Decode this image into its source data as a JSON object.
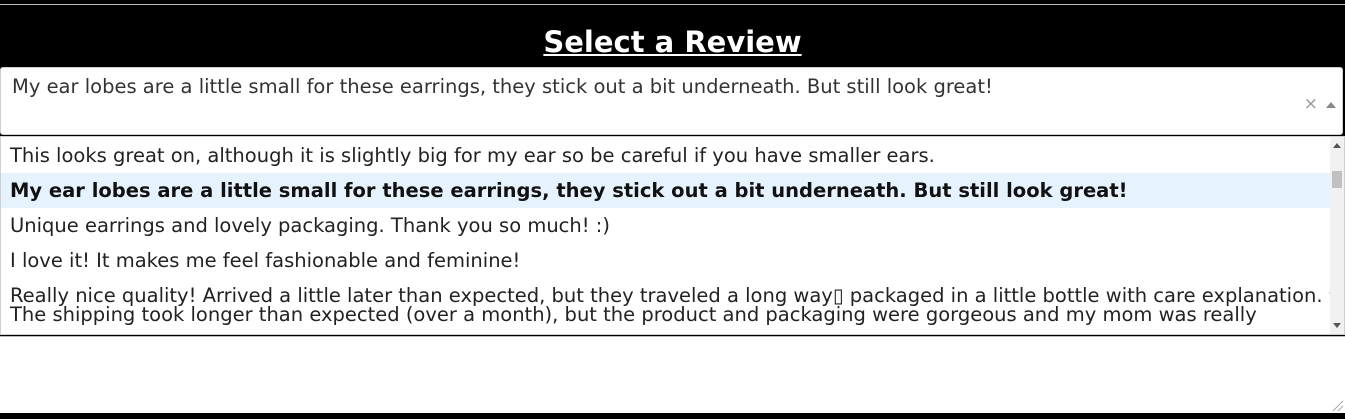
{
  "page": {
    "title": "Select a Review"
  },
  "select": {
    "value": "My ear lobes are a little small for these earrings, they stick out a bit underneath. But still look great!",
    "clear_glyph": "×"
  },
  "options": [
    {
      "label": "This looks great on, although it is slightly big for my ear so be careful if you have smaller ears.",
      "selected": false
    },
    {
      "label": "My ear lobes are a little small for these earrings, they stick out a bit underneath. But still look great!",
      "selected": true
    },
    {
      "label": "Unique earrings and lovely packaging. Thank you so much! :)",
      "selected": false
    },
    {
      "label": "I love it! It makes me feel fashionable and feminine!",
      "selected": false
    },
    {
      "label": "Really nice quality! Arrived a little later than expected, but they traveled a long way▯ packaged in a little bottle with care explanation. ❤",
      "selected": false
    },
    {
      "label": "The shipping took longer than expected (over a month), but the product and packaging were gorgeous and my mom was really",
      "selected": false
    }
  ],
  "colors": {
    "background": "#000000",
    "highlight": "#e6f2fe"
  }
}
